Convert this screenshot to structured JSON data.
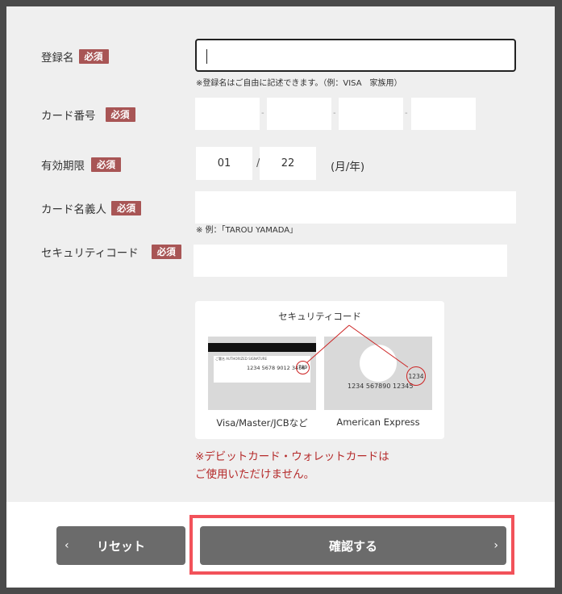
{
  "fields": {
    "registration_name": {
      "label": "登録名",
      "required": "必須",
      "value": "",
      "note": "※登録名はご自由に記述できます。（例：VISA　家族用）"
    },
    "card_number": {
      "label": "カード番号",
      "required": "必須",
      "separator": "-"
    },
    "expiry": {
      "label": "有効期限",
      "required": "必須",
      "month": "01",
      "year": "22",
      "slash": "/",
      "unit": "(月/年)"
    },
    "card_holder": {
      "label": "カード名義人",
      "required": "必須",
      "value": "",
      "note": "※ 例：「TAROU YAMADA」"
    },
    "security_code": {
      "label": "セキュリティコード",
      "required": "必須",
      "value": ""
    }
  },
  "security_help": {
    "title": "セキュリティコード",
    "visa_card": {
      "signature_text": "ご署名  AUTHORIZED SIGNATURE",
      "number": "1234 5678 9012 3456",
      "code": "789",
      "caption": "Visa/Master/JCBなど"
    },
    "amex_card": {
      "number": "1234 567890 12345",
      "code": "1234",
      "caption": "American Express"
    }
  },
  "warning": {
    "line1": "※デビットカード・ウォレットカードは",
    "line2": "ご使用いただけません。"
  },
  "buttons": {
    "reset": "リセット",
    "confirm": "確認する",
    "reset_arrow": "‹",
    "confirm_arrow": "›"
  },
  "colors": {
    "required_badge": "#a85555",
    "button": "#6b6b6b",
    "warning": "#b52b2b",
    "highlight": "#f2525a"
  }
}
